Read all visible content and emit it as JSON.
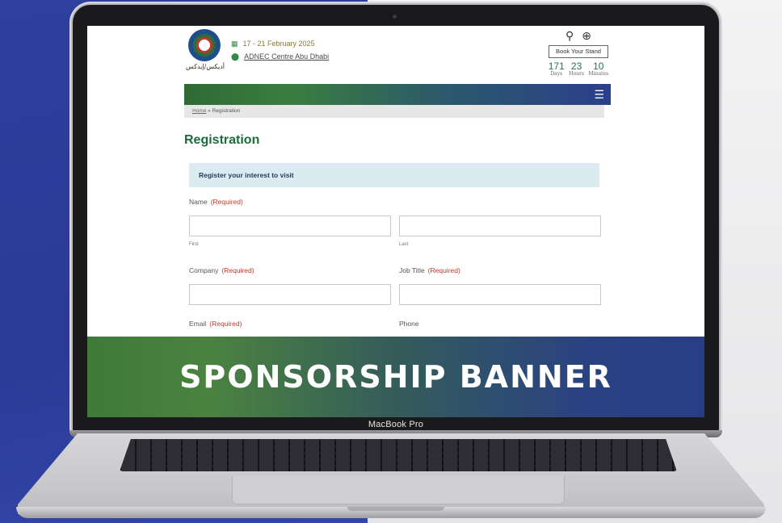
{
  "device": {
    "brand_label": "MacBook Pro"
  },
  "site": {
    "logo_text": "أديكس/إيدكس",
    "event_date": "17 - 21 February 2025",
    "event_location": "ADNEC Centre Abu Dhabi",
    "book_stand_label": "Book Your Stand",
    "countdown": [
      {
        "value": "171",
        "label": "Days"
      },
      {
        "value": "23",
        "label": "Hours"
      },
      {
        "value": "10",
        "label": "Minutes"
      }
    ],
    "breadcrumb": {
      "home": "Home",
      "separator": " » ",
      "current": "Registration"
    },
    "page_title": "Registration",
    "notice": "Register your interest to visit",
    "form": {
      "required_text": "(Required)",
      "name_label": "Name",
      "first_sublabel": "First",
      "last_sublabel": "Last",
      "company_label": "Company",
      "job_title_label": "Job Title",
      "email_label": "Email",
      "phone_label": "Phone"
    }
  },
  "banner": {
    "text": "SPONSORSHIP BANNER"
  },
  "colors": {
    "brand_green": "#1e6a3c",
    "brand_blue": "#2b3f8c",
    "required_red": "#c0392b",
    "background_blue": "#2f3f9e"
  }
}
